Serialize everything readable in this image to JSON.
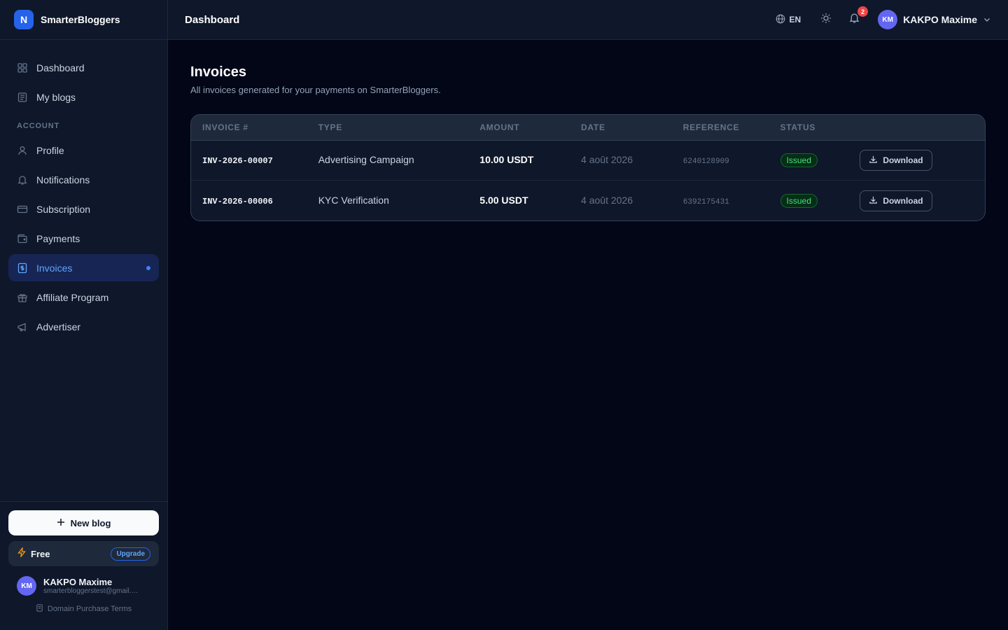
{
  "app": {
    "logo_letter": "N",
    "name": "SmarterBloggers"
  },
  "sidebar": {
    "items_main": [
      {
        "label": "Dashboard",
        "icon": "grid-icon"
      },
      {
        "label": "My blogs",
        "icon": "newspaper-icon"
      }
    ],
    "section_label": "ACCOUNT",
    "items_account": [
      {
        "label": "Profile",
        "icon": "user-icon"
      },
      {
        "label": "Notifications",
        "icon": "bell-icon"
      },
      {
        "label": "Subscription",
        "icon": "credit-card-icon"
      },
      {
        "label": "Payments",
        "icon": "wallet-icon"
      },
      {
        "label": "Invoices",
        "icon": "receipt-icon",
        "active": true
      },
      {
        "label": "Affiliate Program",
        "icon": "gift-icon"
      },
      {
        "label": "Advertiser",
        "icon": "megaphone-icon"
      }
    ],
    "new_blog_label": "New blog",
    "plan_label": "Free",
    "upgrade_label": "Upgrade",
    "user_initials": "KM",
    "user_name": "KAKPO Maxime",
    "user_email": "smarterbloggerstest@gmail.com",
    "terms_label": "Domain Purchase Terms"
  },
  "header": {
    "title": "Dashboard",
    "lang": "EN",
    "notification_count": "2",
    "user_initials": "KM",
    "user_name": "KAKPO Maxime"
  },
  "page": {
    "title": "Invoices",
    "subtitle": "All invoices generated for your payments on SmarterBloggers."
  },
  "table": {
    "columns": [
      "INVOICE #",
      "TYPE",
      "AMOUNT",
      "DATE",
      "REFERENCE",
      "STATUS"
    ],
    "rows": [
      {
        "invoice": "INV-2026-00007",
        "type": "Advertising Campaign",
        "amount": "10.00 USDT",
        "date": "4 août 2026",
        "reference": "6240128909",
        "status": "Issued",
        "action": "Download"
      },
      {
        "invoice": "INV-2026-00006",
        "type": "KYC Verification",
        "amount": "5.00 USDT",
        "date": "4 août 2026",
        "reference": "6392175431",
        "status": "Issued",
        "action": "Download"
      }
    ]
  },
  "colors": {
    "background": "#020617",
    "surface": "#0f172a",
    "accent": "#2563eb",
    "active_bg": "#172554",
    "status_green": "#4ade80",
    "badge_red": "#ef4444"
  }
}
